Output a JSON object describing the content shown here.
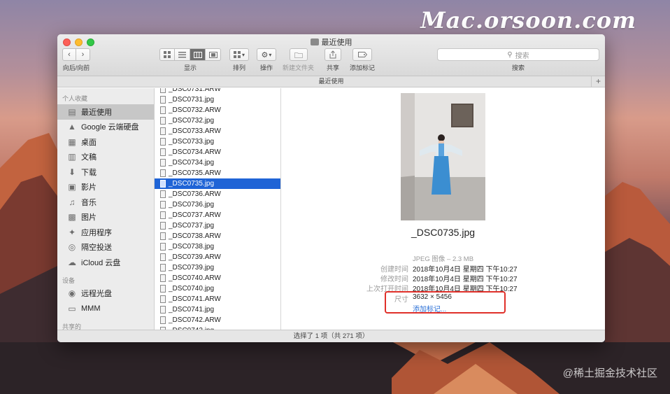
{
  "watermark_top": "Mac.orsoon.com",
  "watermark_bottom": "@稀土掘金技术社区",
  "window": {
    "title": "最近使用",
    "path_title": "最近使用",
    "status": "选择了 1 项（共 271 项）"
  },
  "toolbar": {
    "nav_label": "向后/向前",
    "view_label": "显示",
    "arrange_label": "排列",
    "action_label": "操作",
    "new_folder_label": "新建文件夹",
    "share_label": "共享",
    "tags_label": "添加标记",
    "search_label": "搜索",
    "search_placeholder": "搜索"
  },
  "sidebar": {
    "favorites_header": "个人收藏",
    "favorites": [
      {
        "label": "最近使用",
        "icon": "recents-icon"
      },
      {
        "label": "Google 云端硬盘",
        "icon": "google-drive-icon"
      },
      {
        "label": "桌面",
        "icon": "desktop-icon"
      },
      {
        "label": "文稿",
        "icon": "documents-icon"
      },
      {
        "label": "下载",
        "icon": "downloads-icon"
      },
      {
        "label": "影片",
        "icon": "movies-icon"
      },
      {
        "label": "音乐",
        "icon": "music-icon"
      },
      {
        "label": "图片",
        "icon": "pictures-icon"
      },
      {
        "label": "应用程序",
        "icon": "applications-icon"
      },
      {
        "label": "隔空投送",
        "icon": "airdrop-icon"
      },
      {
        "label": "iCloud 云盘",
        "icon": "icloud-icon"
      }
    ],
    "devices_header": "设备",
    "devices": [
      {
        "label": "远程光盘",
        "icon": "remote-disc-icon"
      },
      {
        "label": "MMM",
        "icon": "disk-icon"
      }
    ],
    "shared_header": "共享的"
  },
  "files": [
    "_DSC0731.ARW",
    "_DSC0731.jpg",
    "_DSC0732.ARW",
    "_DSC0732.jpg",
    "_DSC0733.ARW",
    "_DSC0733.jpg",
    "_DSC0734.ARW",
    "_DSC0734.jpg",
    "_DSC0735.ARW",
    "_DSC0735.jpg",
    "_DSC0736.ARW",
    "_DSC0736.jpg",
    "_DSC0737.ARW",
    "_DSC0737.jpg",
    "_DSC0738.ARW",
    "_DSC0738.jpg",
    "_DSC0739.ARW",
    "_DSC0739.jpg",
    "_DSC0740.ARW",
    "_DSC0740.jpg",
    "_DSC0741.ARW",
    "_DSC0741.jpg",
    "_DSC0742.ARW",
    "_DSC0742.jpg"
  ],
  "selected_file": "_DSC0735.jpg",
  "preview": {
    "name": "_DSC0735.jpg",
    "kind": "JPEG 图像 – 2.3 MB",
    "rows": [
      {
        "key": "创建时间",
        "value": "2018年10月4日 星期四 下午10:27"
      },
      {
        "key": "修改时间",
        "value": "2018年10月4日 星期四 下午10:27"
      },
      {
        "key": "上次打开时间",
        "value": "2018年10月4日 星期四 下午10:27"
      },
      {
        "key": "尺寸",
        "value": "3632 × 5456"
      }
    ],
    "add_tags": "添加标记..."
  }
}
